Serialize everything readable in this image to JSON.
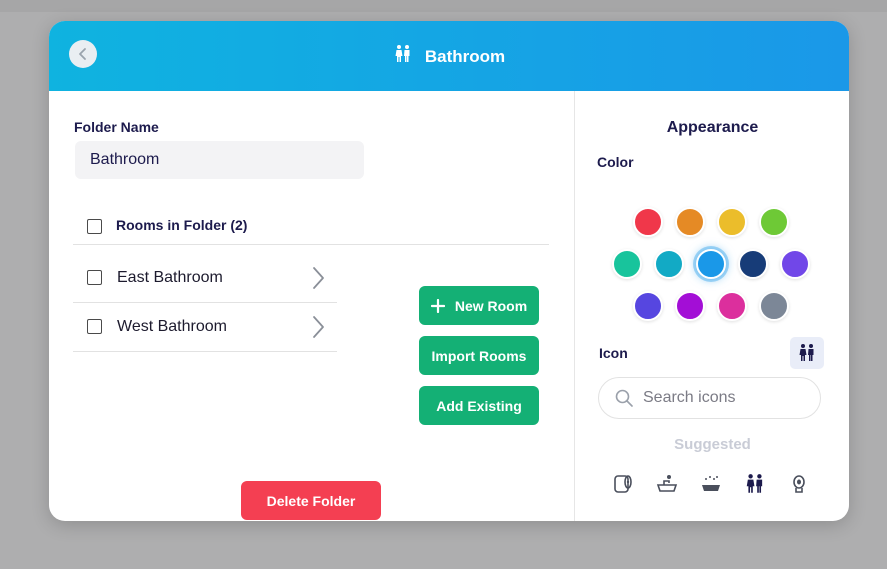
{
  "header": {
    "title": "Bathroom",
    "icon": "restroom-icon",
    "gradient": [
      "#0fb3e0",
      "#1a98e8"
    ]
  },
  "folder": {
    "name_label": "Folder Name",
    "name_value": "Bathroom"
  },
  "rooms": {
    "header_label": "Rooms in Folder (2)",
    "items": [
      {
        "label": "East Bathroom"
      },
      {
        "label": "West Bathroom"
      }
    ]
  },
  "actions": {
    "new_room": "New Room",
    "import_rooms": "Import Rooms",
    "add_existing": "Add Existing",
    "delete_folder": "Delete Folder",
    "primary_color": "#14b075",
    "danger_color": "#f43f52"
  },
  "appearance": {
    "title": "Appearance",
    "color_label": "Color",
    "colors": [
      {
        "hex": "#f0374a",
        "selected": false
      },
      {
        "hex": "#e58a25",
        "selected": false
      },
      {
        "hex": "#ebbd2b",
        "selected": false
      },
      {
        "hex": "#6ec936",
        "selected": false
      },
      {
        "hex": "#18c49c",
        "selected": false
      },
      {
        "hex": "#12aac5",
        "selected": false
      },
      {
        "hex": "#1a98e8",
        "selected": true
      },
      {
        "hex": "#173c78",
        "selected": false
      },
      {
        "hex": "#7147e8",
        "selected": false
      },
      {
        "hex": "#5646e0",
        "selected": false
      },
      {
        "hex": "#a30ed6",
        "selected": false
      },
      {
        "hex": "#dc2f9d",
        "selected": false
      },
      {
        "hex": "#7c8797",
        "selected": false
      }
    ],
    "icon_label": "Icon",
    "selected_icon": "restroom-icon",
    "search_placeholder": "Search icons",
    "suggested_label": "Suggested",
    "suggested_icons": [
      "toilet-paper-icon",
      "faucet-sink-icon",
      "shower-tub-icon",
      "restroom-icon",
      "toilet-icon"
    ]
  }
}
